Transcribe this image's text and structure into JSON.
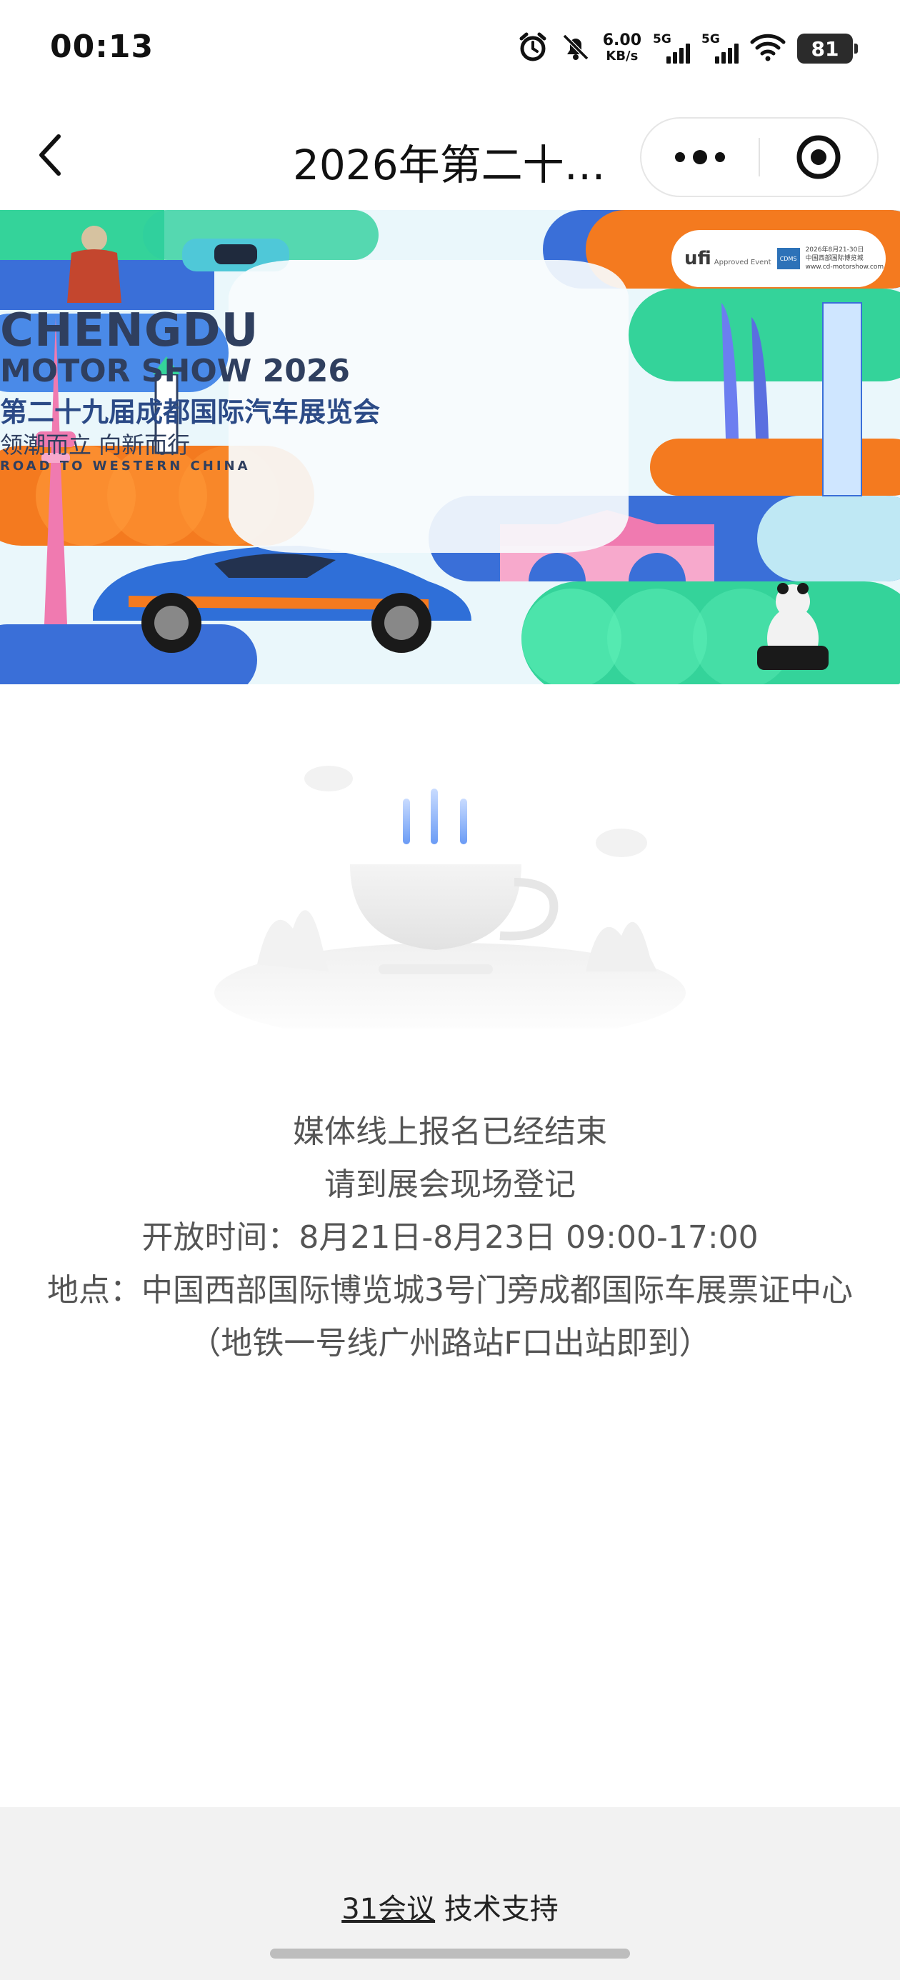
{
  "status_bar": {
    "time": "00:13",
    "net_speed_value": "6.00",
    "net_speed_unit": "KB/s",
    "sim1_label": "5G",
    "sim2_label": "5G",
    "battery": "81",
    "icons": [
      "alarm-icon",
      "mute-bell-icon",
      "signal-icon",
      "wifi-icon",
      "battery-icon"
    ]
  },
  "nav": {
    "title": "2026年第二十…",
    "back_icon": "chevron-left-icon",
    "more_icon": "more-dots-icon",
    "close_icon": "target-close-icon"
  },
  "banner": {
    "title": "CHENGDU",
    "subtitle": "MOTOR SHOW 2026",
    "cn_title": "第二十九届成都国际汽车展览会",
    "slogan": "领潮而立 向新而行",
    "tagline": "ROAD TO WESTERN CHINA",
    "ufi_logo": "ufi",
    "ufi_note": "Approved Event",
    "cdms_logo": "CDMS",
    "info_line1": "2026年8月21-30日",
    "info_line2": "中国西部国际博览城",
    "info_line3": "www.cd-motorshow.com",
    "colors": {
      "blue": "#3a6fd8",
      "orange": "#f47a1f",
      "green": "#34d39a",
      "light_blue": "#bfe8f4",
      "pink": "#f07ab0"
    }
  },
  "message": {
    "line1": "媒体线上报名已经结束",
    "line2": "请到展会现场登记",
    "line3": "开放时间：8月21日-8月23日 09:00-17:00",
    "line4": "地点：中国西部国际博览城3号门旁成都国际车展票证中心",
    "line5": "（地铁一号线广州路站F口出站即到）"
  },
  "footer": {
    "link_label": "31会议",
    "support_label": " 技术支持"
  }
}
